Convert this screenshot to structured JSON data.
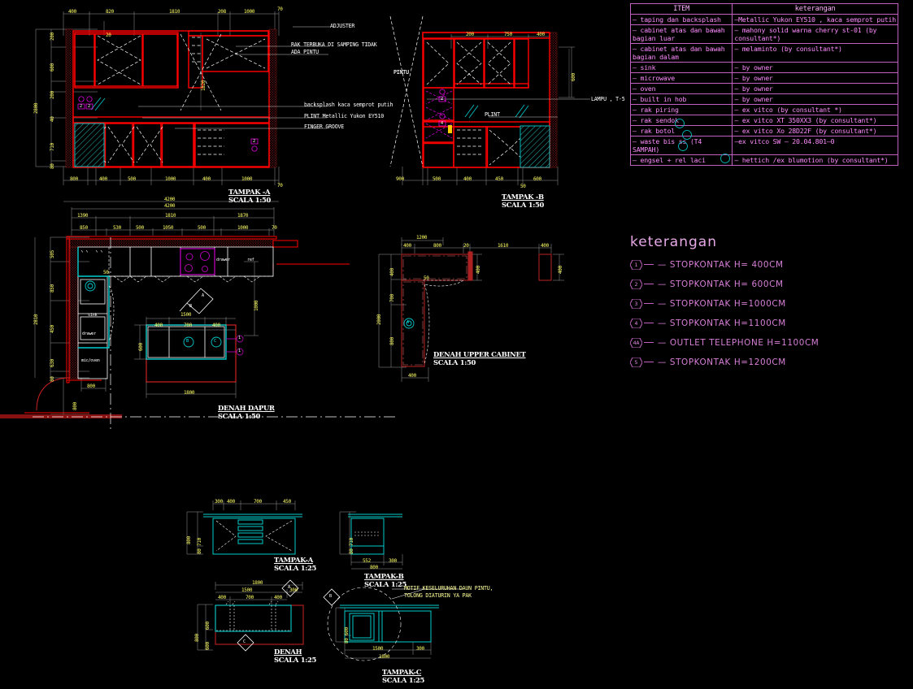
{
  "app": {
    "kind": "autocad-drawing",
    "background": "#000000",
    "colors": {
      "red": "#ff0000",
      "yellow": "#ffff66",
      "cyan": "#00ffff",
      "magenta": "#ff00ff",
      "white": "#ffffff",
      "violet": "#c060c0",
      "grey": "#999999"
    }
  },
  "spec_table": {
    "headers": [
      "ITEM",
      "keterangan"
    ],
    "rows": [
      {
        "item": "— taping dan backsplash",
        "spec": "—Metallic Yukon EY510 , kaca semprot putih"
      },
      {
        "item": "— cabinet atas dan bawah bagian luar",
        "spec": "— mahony solid warna cherry st-01 (by consultant*)"
      },
      {
        "item": "— cabinet atas dan bawah bagian dalam",
        "spec": "— melaminto (by consultant*)"
      },
      {
        "item": "— sink",
        "spec": "— by owner"
      },
      {
        "item": "— microwave",
        "spec": "— by owner"
      },
      {
        "item": "— oven",
        "spec": "— by owner"
      },
      {
        "item": "— built in hob",
        "spec": "— by owner"
      },
      {
        "item": "— rak piring",
        "spec": "— ex vitco (by consultant *)",
        "marker": "A"
      },
      {
        "item": "— rak sendok",
        "spec": "— ex vitco XT 350XX3 (by consultant*)",
        "marker": "B"
      },
      {
        "item": "— rak botol",
        "spec": "— ex vitco Xo 28D22F (by consultant*)",
        "marker": "C"
      },
      {
        "item": "— waste bis ss (T4 SAMPAH)",
        "spec": "—ex vitco SW — 20.04.801—0",
        "marker": "D"
      },
      {
        "item": "— engsel + rel laci",
        "spec": "— hettich /ex blumotion (by consultant*)"
      }
    ]
  },
  "keterangan": {
    "title": "keterangan",
    "items": [
      {
        "num": "1",
        "text": "— STOPKONTAK  H=  400CM"
      },
      {
        "num": "2",
        "text": "— STOPKONTAK  H=  600CM"
      },
      {
        "num": "3",
        "text": "— STOPKONTAK  H=1000CM"
      },
      {
        "num": "4",
        "text": "— STOPKONTAK  H=1100CM"
      },
      {
        "num": "4A",
        "text": "— OUTLET  TELEPHONE  H=1100CM"
      },
      {
        "num": "5",
        "text": "— STOPKONTAK  H=1200CM"
      }
    ]
  },
  "views": {
    "tampak_a": {
      "title": "TAMPAK -A",
      "scale": "SCALA 1:50",
      "dims_top": [
        "400",
        "820",
        "1810",
        "208",
        "1000",
        "70"
      ],
      "dims_top_inner": [
        "20"
      ],
      "dims_bottom": [
        "800",
        "400",
        "500",
        "1000",
        "400",
        "1000",
        "70"
      ],
      "dims_overall_bottom": "4200",
      "dims_left": [
        "200",
        "600",
        "200",
        "40",
        "710",
        "80"
      ],
      "dims_left_overall": "2800",
      "dims_inner": [
        "1820"
      ],
      "notes": [
        "ADJUSTER",
        "RAK TERBUKA DI SAMPING TIDAK",
        "ADA PINTU",
        "backsplash kaca semprot putih",
        "PLINT Metallic Yukon EY510",
        "FINGER GROOVE",
        "PINTU"
      ],
      "outlets": [
        "2",
        "2",
        "2"
      ]
    },
    "tampak_b": {
      "title": "TAMPAK -B",
      "scale": "SCALA 1:50",
      "dims_top": [
        "200",
        "750",
        "400"
      ],
      "dims_right": [
        "600"
      ],
      "dims_bottom": [
        "900",
        "500",
        "400",
        "450",
        "600",
        "50"
      ],
      "notes": [
        "PINTU",
        "LAMPU , T-5",
        "PLINT"
      ],
      "outlets": [
        "2",
        "4",
        "1"
      ]
    },
    "denah_dapur": {
      "title": "DENAH DAPUR",
      "scale": "SCALA 1:50",
      "dims_top_overall": "4200",
      "dims_top_row2": [
        "1390",
        "1810",
        "1870"
      ],
      "dims_top_row3": [
        "850",
        "530",
        "500",
        "1050",
        "500",
        "1000",
        "70"
      ],
      "dims_left": [
        "505",
        "850",
        "450",
        "630",
        "80"
      ],
      "dims_left_overall": "2810",
      "dims_bottom": [
        "800"
      ],
      "dims_right": [
        "1000"
      ],
      "island": {
        "dims_top_overall": "1500",
        "dims_top": [
          "400",
          "700",
          "400"
        ],
        "dims_left": "600",
        "dims_bottom": "1800",
        "markers": [
          "B",
          "C"
        ],
        "outlets": [
          "1",
          "1"
        ]
      },
      "labels": [
        "sink",
        "drawer",
        "mic/oven",
        "drawer",
        "ref"
      ],
      "section_marks": [
        "A",
        "B",
        "C"
      ],
      "misc_dims": [
        "50"
      ]
    },
    "denah_upper_cabinet": {
      "title": "DENAH UPPER CABINET",
      "scale": "SCALA 1:50",
      "dims_top": [
        "400",
        "800",
        "20",
        "1610",
        "400"
      ],
      "dims_top_overall": "1200",
      "dims_left": [
        "400",
        "700",
        "800"
      ],
      "dims_left_overall": "2000",
      "dims_right": [
        "400",
        "400"
      ],
      "dims_bottom": [
        "400"
      ],
      "markers": [
        "A"
      ],
      "misc_dims": [
        "50"
      ]
    },
    "detail_tampak_a": {
      "title": "TAMPAK-A",
      "scale": "SCALA 1:25",
      "dims_top": [
        "300",
        "400",
        "700",
        "450"
      ],
      "dims_left": [
        "710",
        "80"
      ],
      "dims_left_overall": "800"
    },
    "detail_tampak_b": {
      "title": "TAMPAK-B",
      "scale": "SCALA 1:25",
      "dims_left": [
        "710",
        "80"
      ],
      "dims_bottom": [
        "552",
        "300"
      ],
      "dims_bottom_overall": "800"
    },
    "detail_denah": {
      "title": "DENAH",
      "scale": "SCALA 1:25",
      "dims_top_overall": "1800",
      "dims_top_row2": [
        "1500",
        "300"
      ],
      "dims_top_row3": [
        "400",
        "700",
        "400"
      ],
      "dims_left": [
        "600",
        "600"
      ],
      "dims_left_overall": "800",
      "markers": [
        "A",
        "B",
        "C"
      ]
    },
    "detail_tampak_c": {
      "title": "TAMPAK-C",
      "scale": "SCALA 1:25",
      "dims_left": [
        "600",
        "80"
      ],
      "dims_bottom": [
        "1500",
        "300"
      ],
      "dims_bottom_overall": "1800",
      "note_line1": "MOTIF KESELURUHAN DAUN PINTU,",
      "note_line2": "TOLONG DIATURIN YA PAK"
    }
  }
}
